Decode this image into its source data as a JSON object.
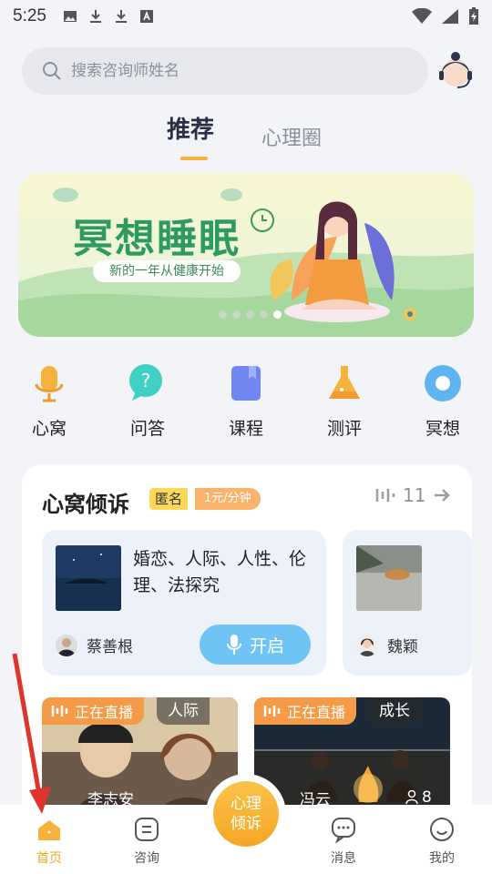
{
  "status_bar": {
    "time": "5:25"
  },
  "search": {
    "placeholder": "搜索咨询师姓名"
  },
  "tabs": [
    {
      "label": "推荐"
    },
    {
      "label": "心理圈"
    }
  ],
  "banner": {
    "title": "冥想睡眠",
    "subtitle": "新的一年从健康开始",
    "pages": 5,
    "active_page": 5
  },
  "categories": [
    {
      "label": "心窝",
      "icon": "microphone-icon"
    },
    {
      "label": "问答",
      "icon": "question-bubble-icon"
    },
    {
      "label": "课程",
      "icon": "book-icon"
    },
    {
      "label": "测评",
      "icon": "flask-icon"
    },
    {
      "label": "冥想",
      "icon": "meditation-disc-icon"
    }
  ],
  "card": {
    "title": "心窝倾诉",
    "tag_anonymous": "匿名",
    "tag_price": "1元/分钟",
    "count": "11",
    "listeners": [
      {
        "topics": "婚恋、人际、人性、伦理、法探究",
        "name": "蔡善根",
        "button": "开启"
      },
      {
        "name": "魏颖"
      }
    ],
    "lives": [
      {
        "badge": "正在直播",
        "tag": "人际",
        "name": "李志安"
      },
      {
        "badge": "正在直播",
        "tag": "成长",
        "name": "冯云",
        "viewers": "8"
      }
    ]
  },
  "bottom_nav": [
    {
      "label": "首页",
      "icon": "home-icon",
      "active": true
    },
    {
      "label": "咨询",
      "icon": "consult-icon"
    },
    {
      "label": "心理倾诉",
      "icon": "center-icon"
    },
    {
      "label": "消息",
      "icon": "message-icon"
    },
    {
      "label": "我的",
      "icon": "profile-icon"
    }
  ],
  "center_button": {
    "line1": "心理",
    "line2": "倾诉"
  },
  "colors": {
    "accent": "#f5a623",
    "banner_title": "#2e9a63",
    "open_button": "#6fc3f5",
    "live_badge": "#f59a47"
  }
}
